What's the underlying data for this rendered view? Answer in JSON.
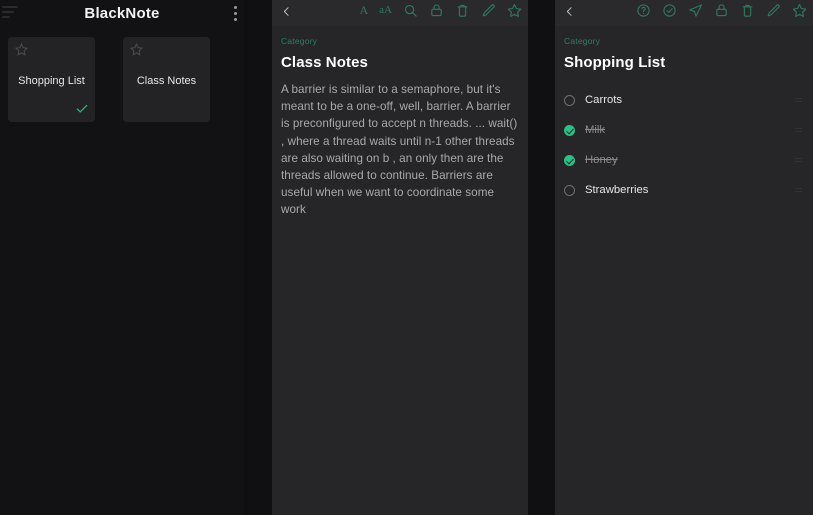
{
  "panel1": {
    "title": "BlackNote",
    "menu_icon": "hamburger-icon",
    "overflow_icon": "kebab-menu-icon",
    "notes": [
      {
        "label": "Shopping List",
        "starred": false,
        "checked": true,
        "star_icon": "star-outline-icon",
        "check_icon": "check-icon"
      },
      {
        "label": "Class Notes",
        "starred": false,
        "checked": false,
        "star_icon": "star-outline-icon",
        "check_icon": ""
      }
    ]
  },
  "panel2": {
    "back_icon": "chevron-left-icon",
    "tools": [
      {
        "name": "font-style-icon",
        "glyph": "A"
      },
      {
        "name": "font-size-icon",
        "glyph": "aA"
      },
      {
        "name": "search-icon",
        "glyph": ""
      },
      {
        "name": "lock-icon",
        "glyph": ""
      },
      {
        "name": "delete-icon",
        "glyph": ""
      },
      {
        "name": "edit-icon",
        "glyph": ""
      },
      {
        "name": "favorite-star-icon",
        "glyph": ""
      }
    ],
    "category": "Category",
    "title": "Class Notes",
    "body": "A barrier is similar to a semaphore, but it's meant to be a one-off, well, barrier. A barrier is preconfigured to accept n threads. ... wait() , where a thread waits until n-1 other threads are also waiting on b , an only then are the threads allowed to continue. Barriers are useful when we want to coordinate some work"
  },
  "panel3": {
    "back_icon": "chevron-left-icon",
    "tools": [
      {
        "name": "help-icon",
        "glyph": ""
      },
      {
        "name": "check-circle-icon",
        "glyph": ""
      },
      {
        "name": "send-icon",
        "glyph": ""
      },
      {
        "name": "lock-icon",
        "glyph": ""
      },
      {
        "name": "delete-icon",
        "glyph": ""
      },
      {
        "name": "edit-icon",
        "glyph": ""
      },
      {
        "name": "favorite-star-icon",
        "glyph": ""
      }
    ],
    "category": "Category",
    "title": "Shopping List",
    "items": [
      {
        "label": "Carrots",
        "done": false
      },
      {
        "label": "Milk",
        "done": true
      },
      {
        "label": "Honey",
        "done": true
      },
      {
        "label": "Strawberries",
        "done": false
      }
    ]
  },
  "colors": {
    "accent_green": "#2fbd86",
    "toolbar_icon_green": "#2f7a5c",
    "category_green": "#2f7f5e",
    "panel_bg": "#262629",
    "list_bg": "#121114",
    "card_bg": "#232326"
  }
}
